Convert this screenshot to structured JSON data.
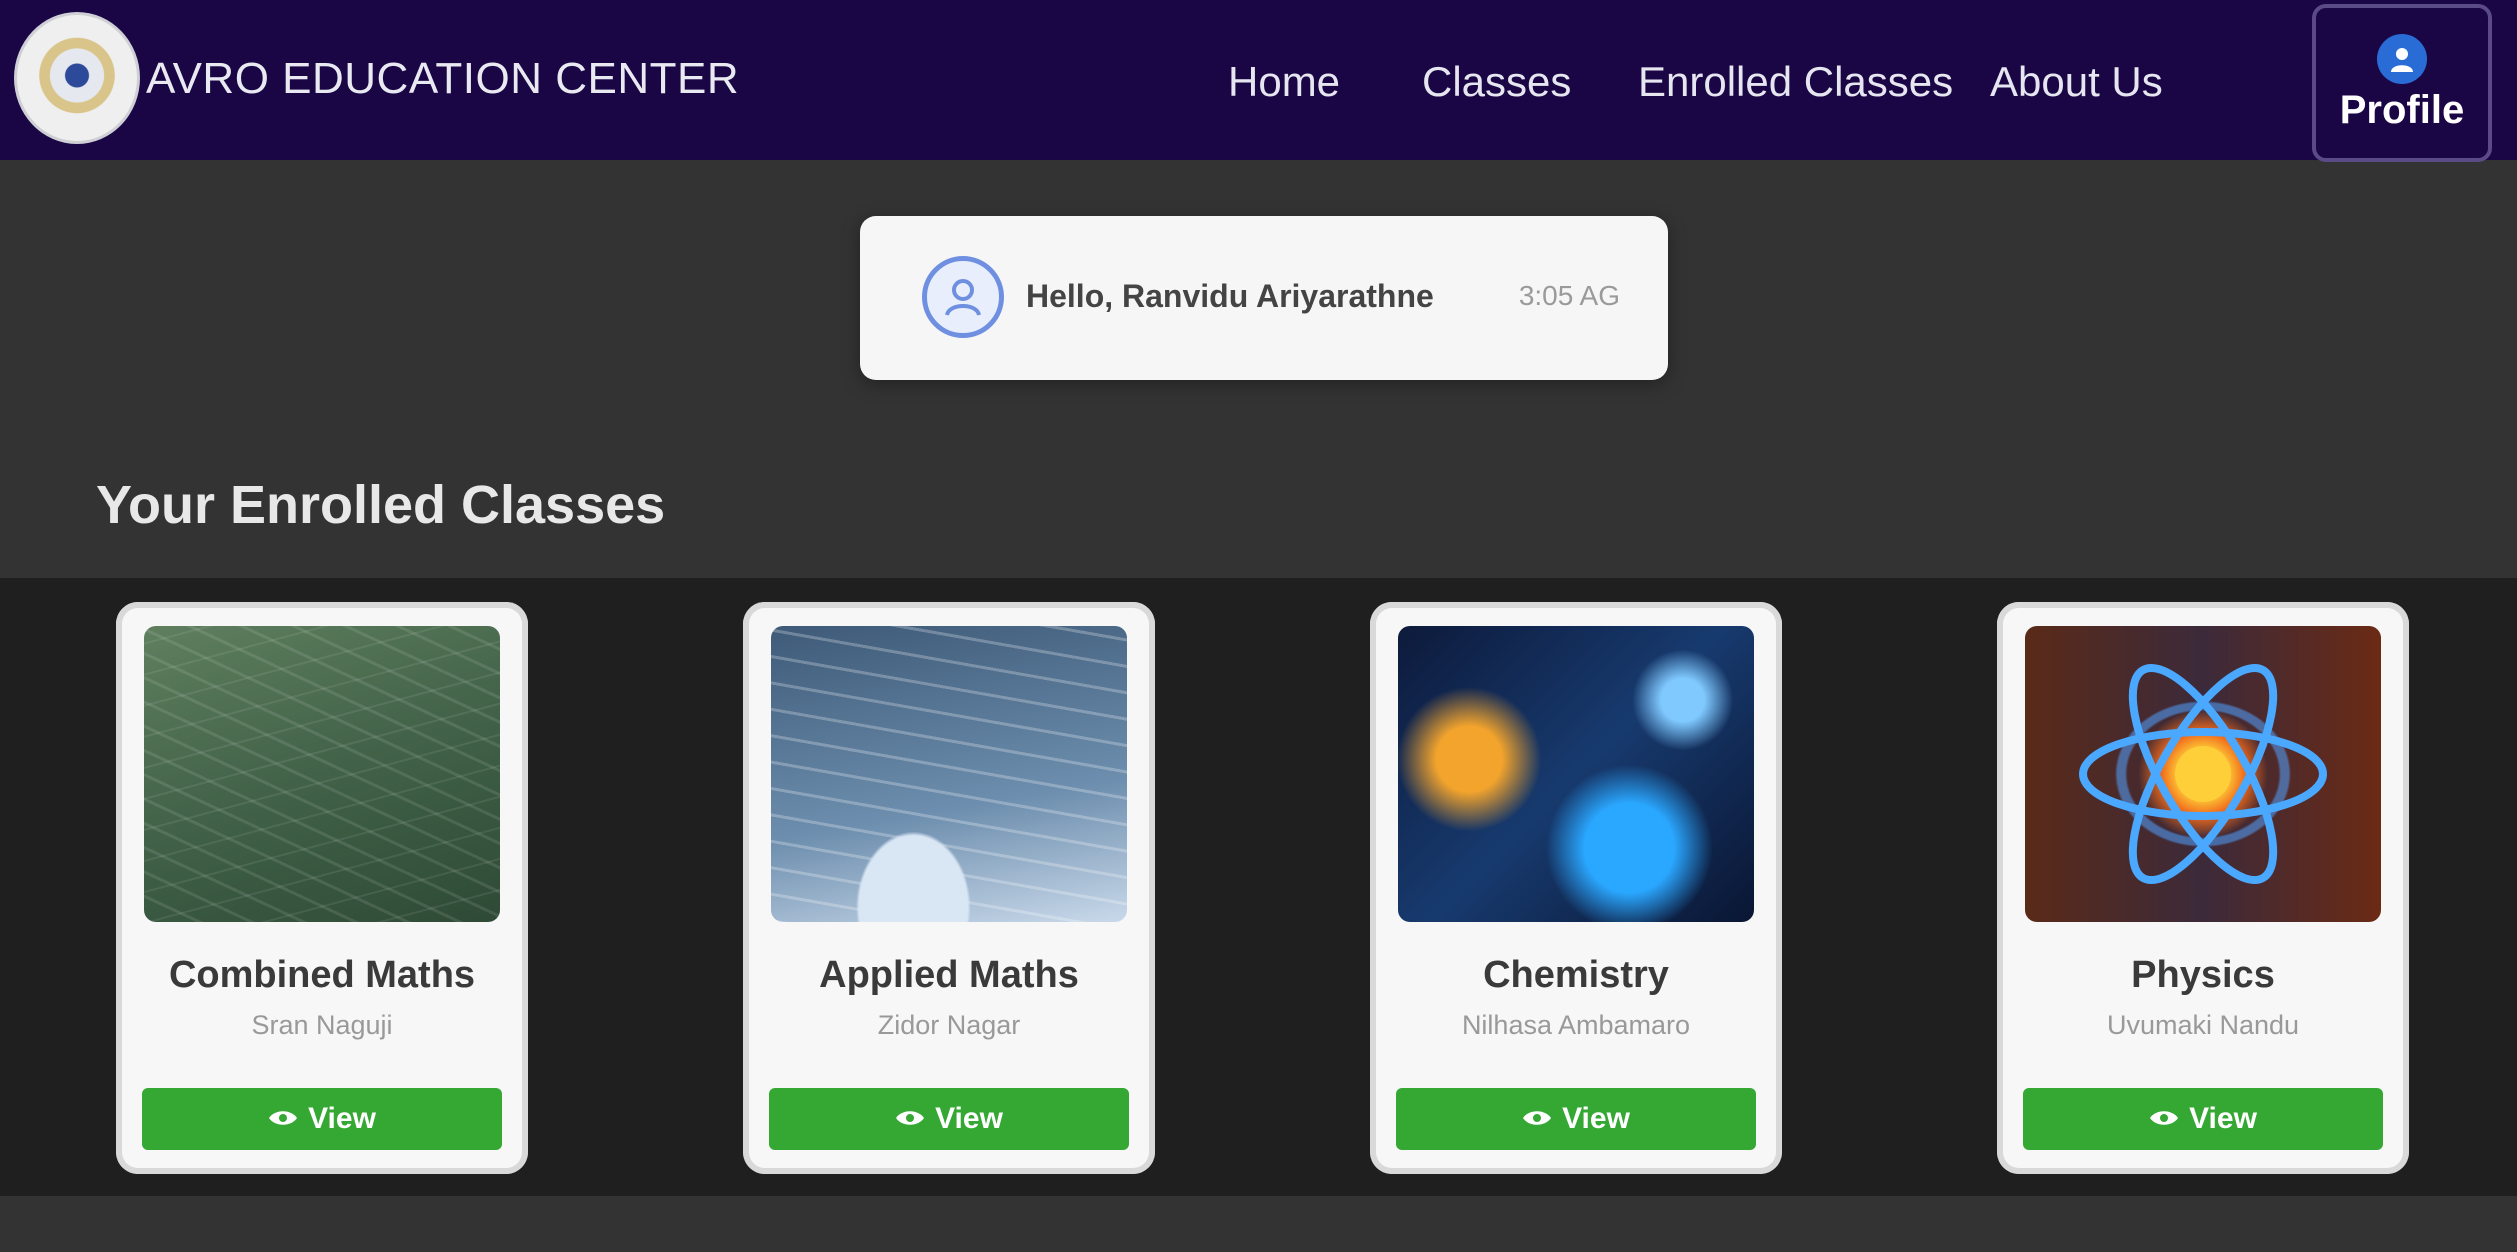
{
  "navbar": {
    "brand": "AVRO EDUCATION CENTER",
    "links": [
      "Home",
      "Classes",
      "Enrolled Classes",
      "About Us"
    ],
    "profile_label": "Profile",
    "colors": {
      "background": "#1b0645",
      "profile_icon": "#2a6cd6"
    }
  },
  "greeting": {
    "text": "Hello, Ranvidu Ariyarathne",
    "time": "3:05 AG"
  },
  "section": {
    "title": "Your Enrolled Classes"
  },
  "classes": [
    {
      "title": "Combined Maths",
      "teacher": "Sran Naguji",
      "button": "View",
      "image_icon": "chalkboard-equations"
    },
    {
      "title": "Applied Maths",
      "teacher": "Zidor Nagar",
      "button": "View",
      "image_icon": "applied-math-formulas"
    },
    {
      "title": "Chemistry",
      "teacher": "Nilhasa Ambamaro",
      "button": "View",
      "image_icon": "chemistry-lab"
    },
    {
      "title": "Physics",
      "teacher": "Uvumaki Nandu",
      "button": "View",
      "image_icon": "atom"
    }
  ],
  "colors": {
    "page_bg": "#333333",
    "band_bg": "#1f1f1f",
    "view_button": "#34a833"
  }
}
